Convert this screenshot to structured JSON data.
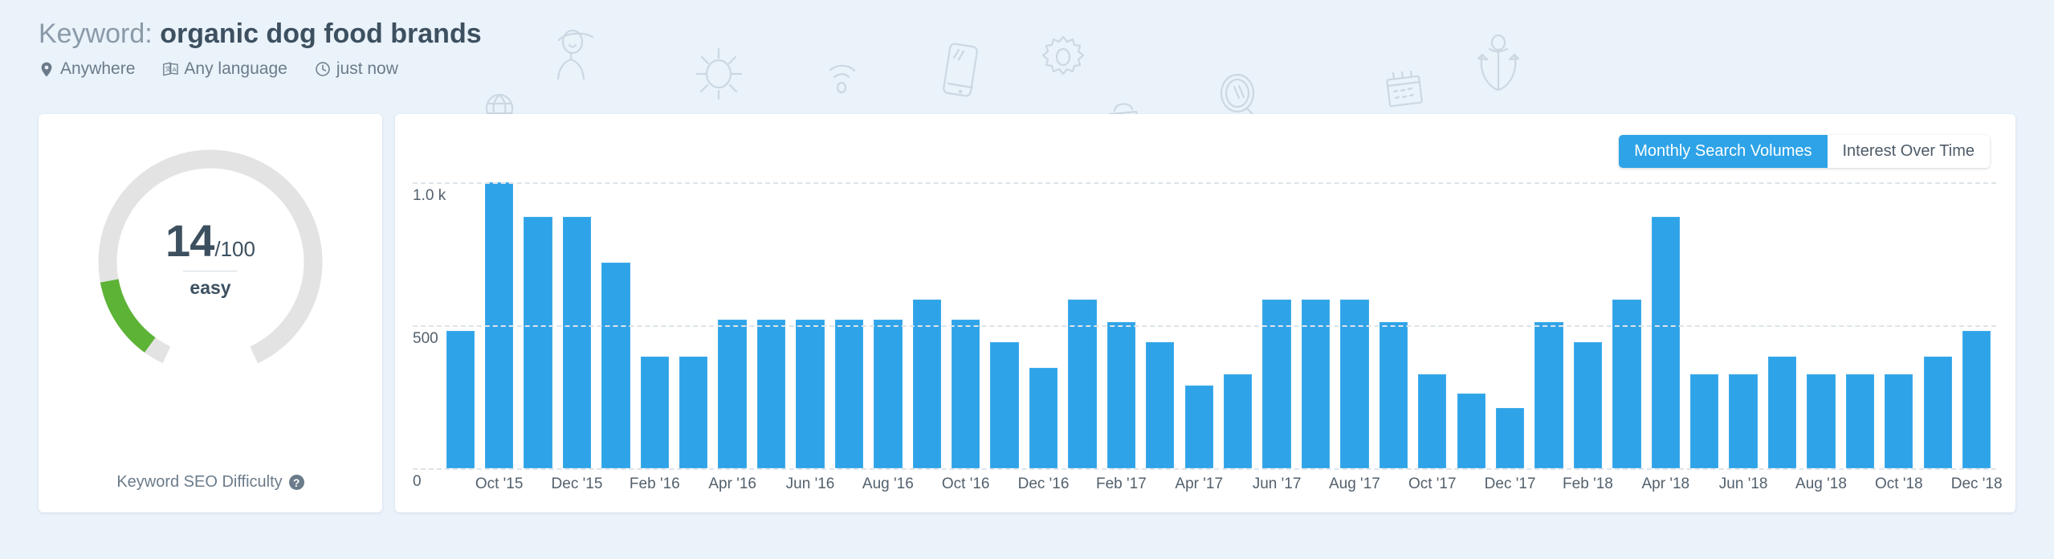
{
  "header": {
    "title_label": "Keyword:",
    "keyword": "organic dog food brands",
    "meta": [
      {
        "icon": "location-pin-icon",
        "label": "Anywhere"
      },
      {
        "icon": "translate-icon",
        "label": "Any language"
      },
      {
        "icon": "clock-icon",
        "label": "just now"
      }
    ]
  },
  "difficulty": {
    "score": "14",
    "out_of": "/100",
    "word": "easy",
    "caption": "Keyword SEO Difficulty",
    "help_glyph": "?",
    "percent": 14,
    "arc_color": "#5cb335",
    "track_color": "#e3e3e3"
  },
  "chart_toggle": {
    "options": [
      {
        "label": "Monthly Search Volumes",
        "active": true
      },
      {
        "label": "Interest Over Time",
        "active": false
      }
    ],
    "active_color": "#2ea3e8"
  },
  "chart_data": {
    "type": "bar",
    "title": "",
    "xlabel": "",
    "ylabel": "",
    "ylim": [
      0,
      1000
    ],
    "grid": true,
    "legend": "none",
    "bar_color": "#2ea3e8",
    "yticks": [
      {
        "value": 1000,
        "label": "1.0 k"
      },
      {
        "value": 500,
        "label": "500"
      },
      {
        "value": 0,
        "label": "0"
      }
    ],
    "categories": [
      "Sep '15",
      "Oct '15",
      "Nov '15",
      "Dec '15",
      "Jan '16",
      "Feb '16",
      "Mar '16",
      "Apr '16",
      "May '16",
      "Jun '16",
      "Jul '16",
      "Aug '16",
      "Sep '16",
      "Oct '16",
      "Nov '16",
      "Dec '16",
      "Jan '17",
      "Feb '17",
      "Mar '17",
      "Apr '17",
      "May '17",
      "Jun '17",
      "Jul '17",
      "Aug '17",
      "Sep '17",
      "Oct '17",
      "Nov '17",
      "Dec '17",
      "Jan '18",
      "Feb '18",
      "Mar '18",
      "Apr '18",
      "May '18",
      "Jun '18",
      "Jul '18",
      "Aug '18",
      "Sep '18",
      "Oct '18",
      "Nov '18",
      "Dec '18"
    ],
    "tick_labels": [
      "",
      "Oct '15",
      "",
      "Dec '15",
      "",
      "Feb '16",
      "",
      "Apr '16",
      "",
      "Jun '16",
      "",
      "Aug '16",
      "",
      "Oct '16",
      "",
      "Dec '16",
      "",
      "Feb '17",
      "",
      "Apr '17",
      "",
      "Jun '17",
      "",
      "Aug '17",
      "",
      "Oct '17",
      "",
      "Dec '17",
      "",
      "Feb '18",
      "",
      "Apr '18",
      "",
      "Jun '18",
      "",
      "Aug '18",
      "",
      "Oct '18",
      "",
      "Dec '18"
    ],
    "values": [
      480,
      1000,
      880,
      880,
      720,
      390,
      390,
      520,
      520,
      520,
      520,
      520,
      590,
      520,
      440,
      350,
      590,
      510,
      440,
      290,
      330,
      590,
      590,
      590,
      510,
      330,
      260,
      210,
      510,
      440,
      590,
      880,
      330,
      330,
      390,
      330,
      330,
      330,
      390,
      480
    ]
  },
  "watermarks": [
    "person-hat-icon",
    "globe-icon",
    "sun-icon",
    "wifi-icon",
    "phone-icon",
    "gear-icon",
    "bag-icon",
    "magnifier-icon",
    "calendar-icon",
    "anchor-icon"
  ]
}
